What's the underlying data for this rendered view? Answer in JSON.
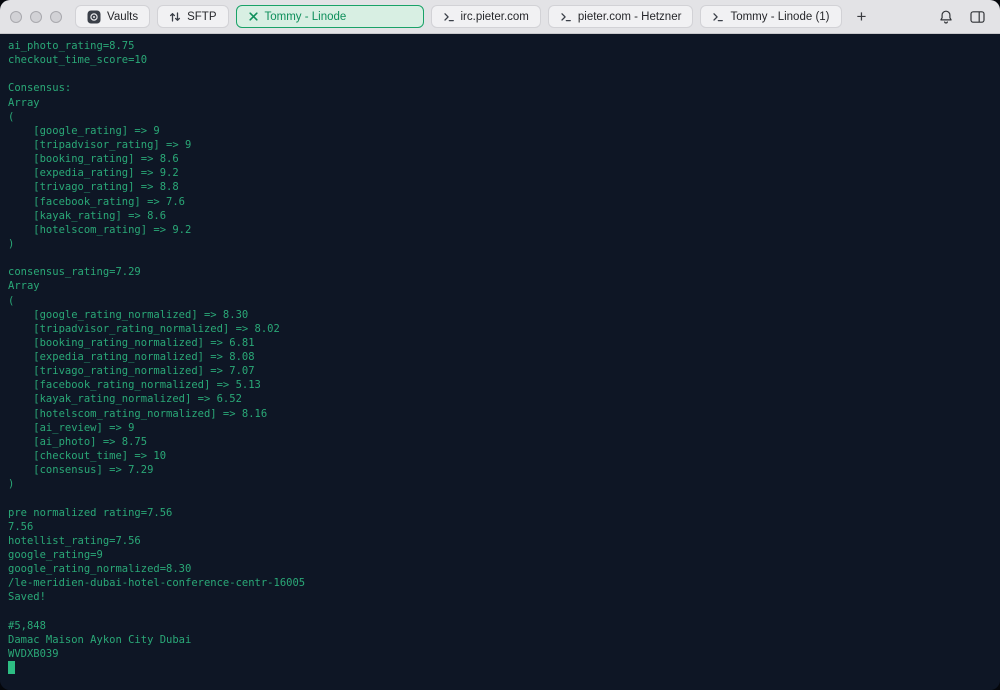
{
  "window": {
    "controls": [
      "close",
      "minimize",
      "zoom"
    ]
  },
  "tabbar": {
    "tabs": [
      {
        "label": "Vaults",
        "icon": "vaults",
        "active": false
      },
      {
        "label": "SFTP",
        "icon": "sftp",
        "active": false
      },
      {
        "label": "Tommy - Linode",
        "icon": "close",
        "active": true
      },
      {
        "label": "irc.pieter.com",
        "icon": "host",
        "active": false
      },
      {
        "label": "pieter.com - Hetzner",
        "icon": "host",
        "active": false
      },
      {
        "label": "Tommy - Linode (1)",
        "icon": "host",
        "active": false
      }
    ],
    "new_tab_label": "+",
    "right_icons": [
      "notifications-bell",
      "panel-toggle"
    ]
  },
  "terminal": {
    "lines": [
      "ai_photo_rating=8.75",
      "checkout_time_score=10",
      "",
      "Consensus:",
      "Array",
      "(",
      "    [google_rating] => 9",
      "    [tripadvisor_rating] => 9",
      "    [booking_rating] => 8.6",
      "    [expedia_rating] => 9.2",
      "    [trivago_rating] => 8.8",
      "    [facebook_rating] => 7.6",
      "    [kayak_rating] => 8.6",
      "    [hotelscom_rating] => 9.2",
      ")",
      "",
      "consensus_rating=7.29",
      "Array",
      "(",
      "    [google_rating_normalized] => 8.30",
      "    [tripadvisor_rating_normalized] => 8.02",
      "    [booking_rating_normalized] => 6.81",
      "    [expedia_rating_normalized] => 8.08",
      "    [trivago_rating_normalized] => 7.07",
      "    [facebook_rating_normalized] => 5.13",
      "    [kayak_rating_normalized] => 6.52",
      "    [hotelscom_rating_normalized] => 8.16",
      "    [ai_review] => 9",
      "    [ai_photo] => 8.75",
      "    [checkout_time] => 10",
      "    [consensus] => 7.29",
      ")",
      "",
      "pre normalized rating=7.56",
      "7.56",
      "hotellist_rating=7.56",
      "google_rating=9",
      "google_rating_normalized=8.30",
      "/le-meridien-dubai-hotel-conference-centr-16005",
      "Saved!",
      "",
      "#5,848",
      "Damac Maison Aykon City Dubai",
      "WVDXB039"
    ],
    "cursor": true
  },
  "colors": {
    "terminal_bg": "#0e1625",
    "terminal_text": "#2aa877",
    "cursor": "#2dbd83",
    "active_tab_bg": "#d8efe3",
    "active_tab_border": "#1aa268",
    "active_tab_text": "#0e8f5b",
    "tabbar_bg": "#e3e3e6"
  }
}
